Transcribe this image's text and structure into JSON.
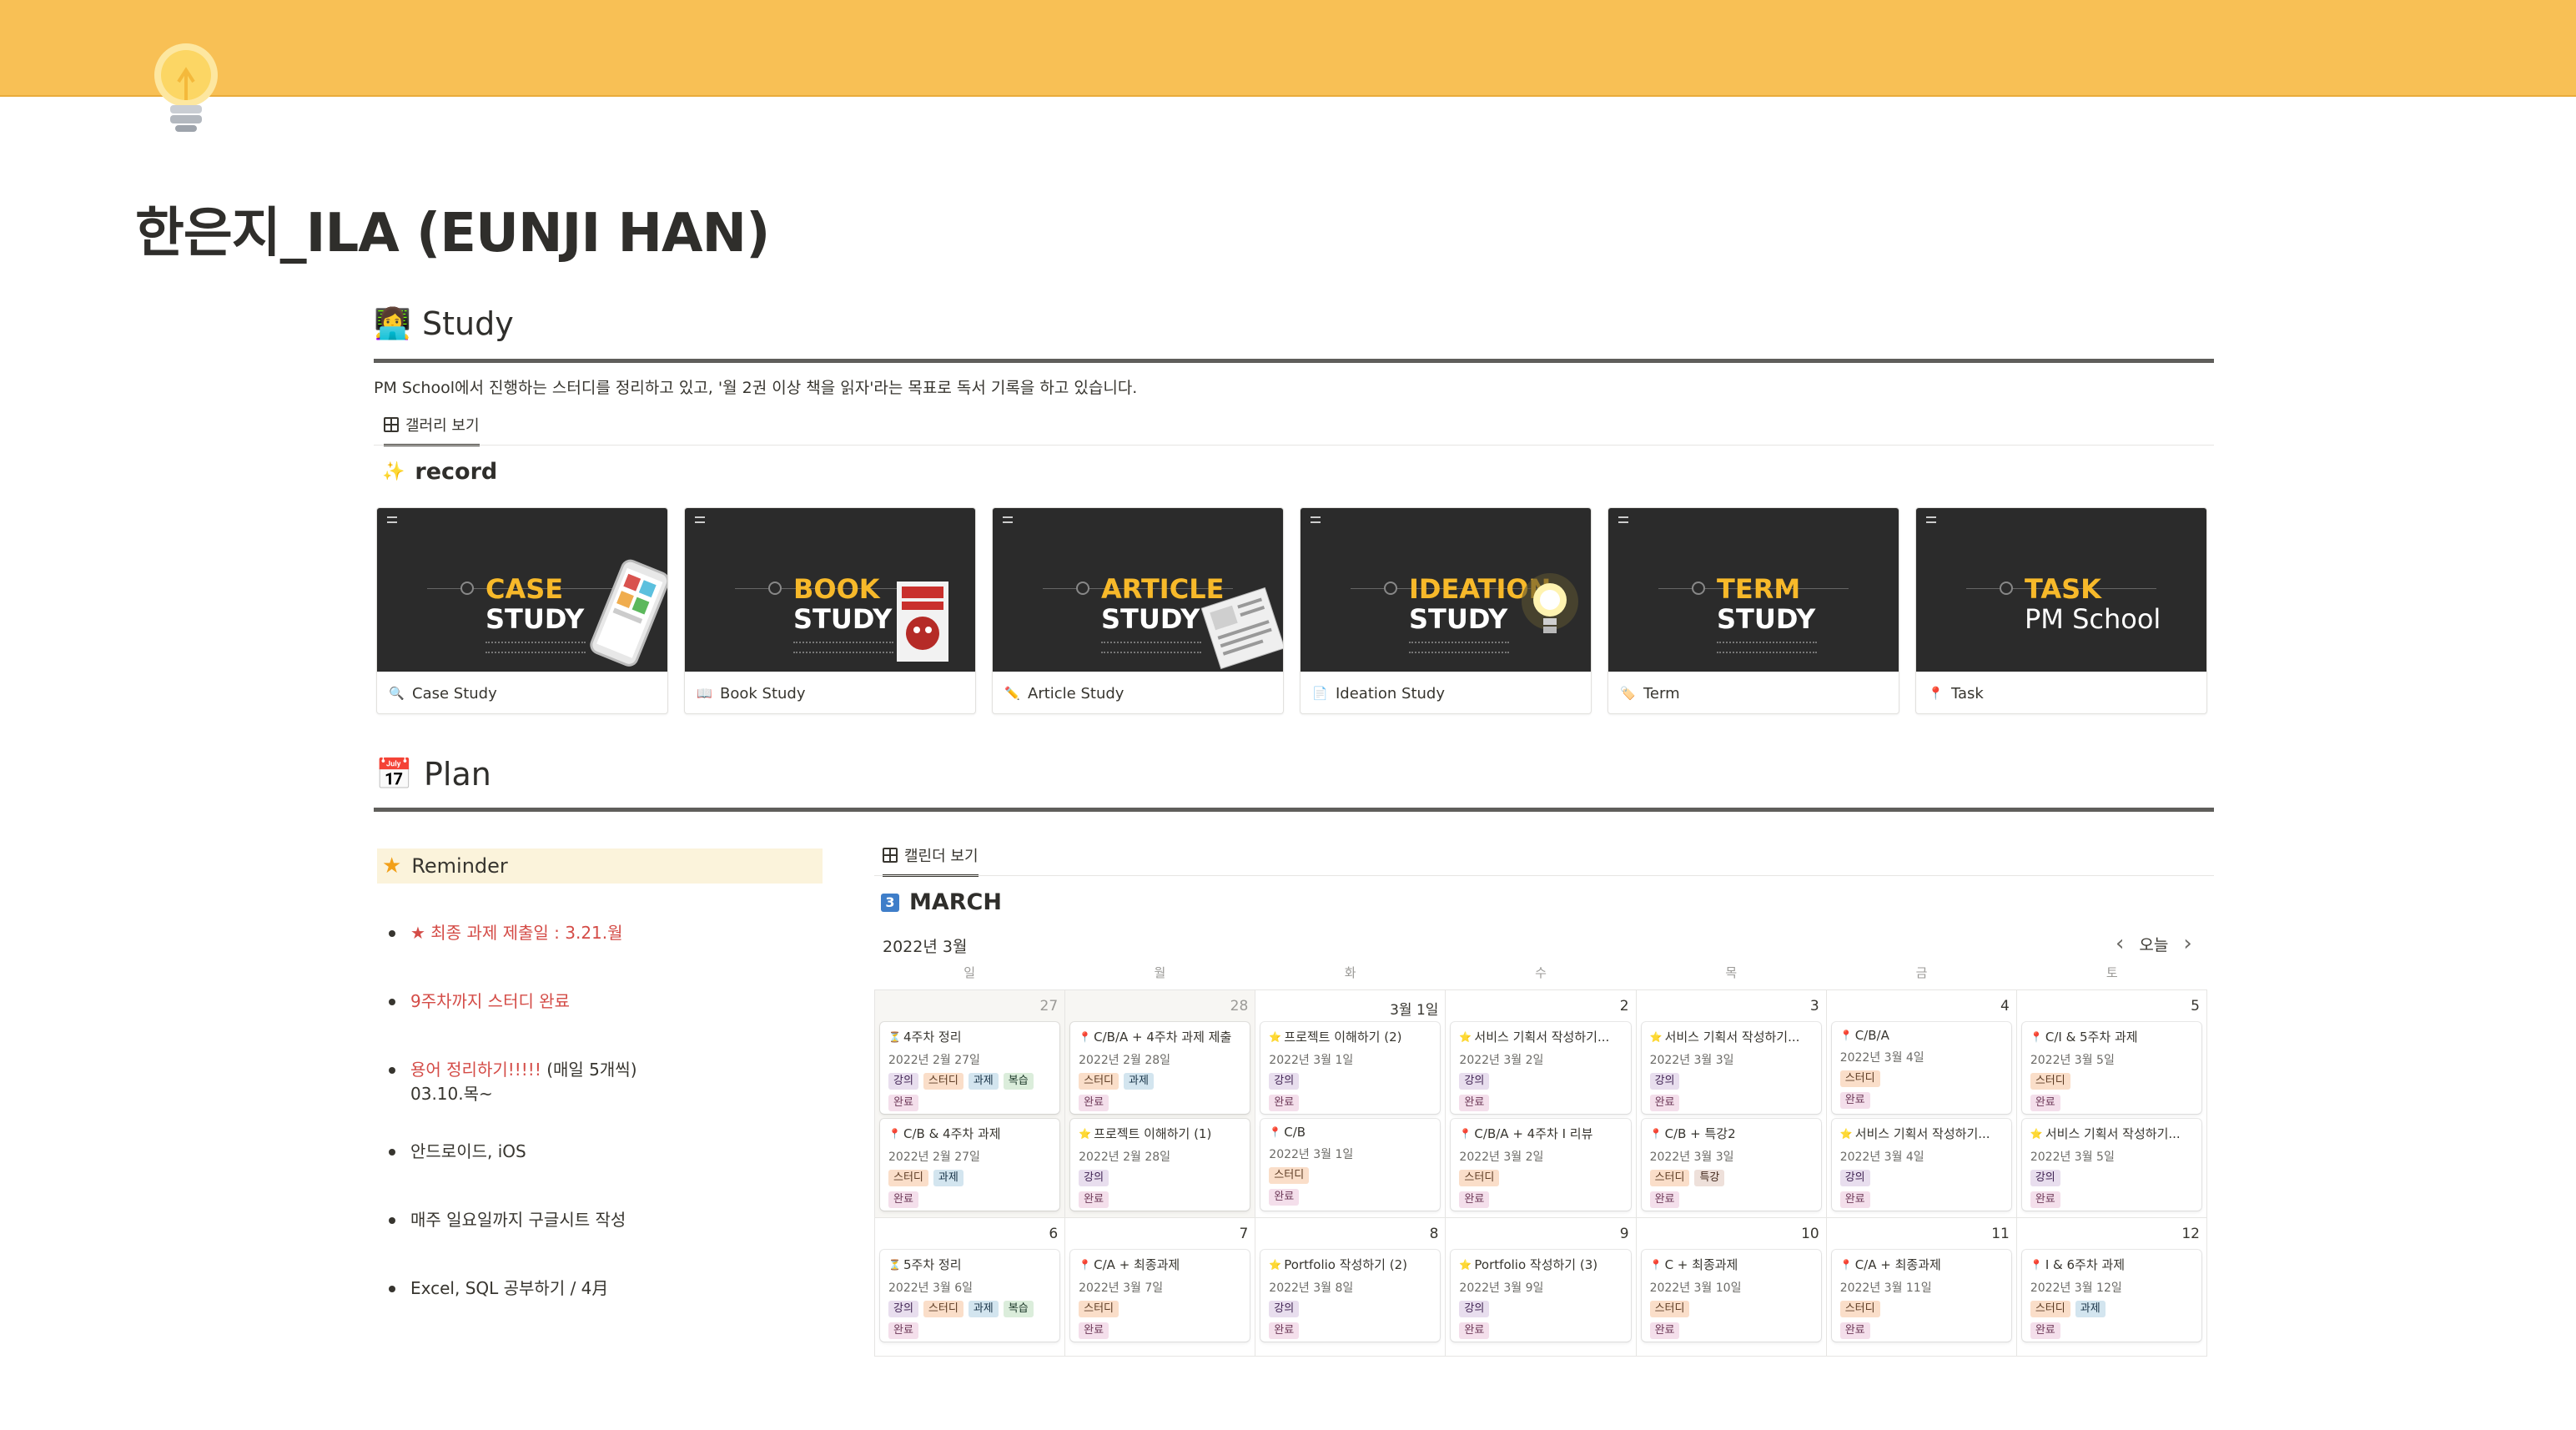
{
  "page": {
    "title": "한은지_ILA (EUNJI HAN)"
  },
  "study": {
    "heading": "Study",
    "description": "PM School에서 진행하는 스터디를 정리하고 있고, '월 2권 이상 책을 읽자'라는 목표로 독서 기록을 하고 있습니다.",
    "view_tab": "갤러리 보기",
    "db_title": "record",
    "cards": [
      {
        "t1": "CASE",
        "t2": "STUDY",
        "name": "Case Study",
        "icon": "magnifier-icon"
      },
      {
        "t1": "BOOK",
        "t2": "STUDY",
        "name": "Book Study",
        "icon": "book-icon"
      },
      {
        "t1": "ARTICLE",
        "t2": "STUDY",
        "name": "Article Study",
        "icon": "pencil-icon"
      },
      {
        "t1": "IDEATION",
        "t2": "STUDY",
        "name": "Ideation Study",
        "icon": "document-icon"
      },
      {
        "t1": "TERM",
        "t2": "STUDY",
        "name": "Term",
        "icon": "tag-icon"
      },
      {
        "t1": "TASK",
        "t2": "PM School",
        "name": "Task",
        "icon": "pin-icon"
      }
    ]
  },
  "plan": {
    "heading": "Plan",
    "reminder": {
      "title": "Reminder",
      "items": [
        {
          "text": "★ 최종 과제 제출일 : 3.21.월",
          "red": true
        },
        {
          "text": "9주차까지 스터디 완료",
          "red": true
        },
        {
          "text": "용어 정리하기!!!!!",
          "red": true,
          "suffix": " (매일 5개씩)",
          "line2": "03.10.목~"
        },
        {
          "text": "안드로이드, iOS"
        },
        {
          "text": "매주 일요일까지 구글시트 작성"
        },
        {
          "text": "Excel, SQL 공부하기 / 4月"
        }
      ]
    },
    "view_tab": "캘린더 보기",
    "db_title": "MARCH",
    "month_label": "2022년 3월",
    "today_label": "오늘",
    "weekdays": [
      "일",
      "월",
      "화",
      "수",
      "목",
      "금",
      "토"
    ],
    "week1": [
      {
        "day": "27",
        "gray": true,
        "events": [
          {
            "icon": "⏳",
            "title": "4주차 정리",
            "date": "2022년 2월 27일",
            "tags": [
              "강의",
              "스터디",
              "과제",
              "복습"
            ],
            "done": "완료"
          },
          {
            "icon": "📍",
            "title": "C/B & 4주차 과제",
            "date": "2022년 2월 27일",
            "tags": [
              "스터디",
              "과제"
            ],
            "done": "완료"
          }
        ]
      },
      {
        "day": "28",
        "gray": true,
        "events": [
          {
            "icon": "📍",
            "title": "C/B/A + 4주차 과제 제출",
            "date": "2022년 2월 28일",
            "tags": [
              "스터디",
              "과제"
            ],
            "done": "완료"
          },
          {
            "icon": "⭐",
            "title": "프로젝트 이해하기 (1)",
            "date": "2022년 2월 28일",
            "tags": [
              "강의"
            ],
            "done": "완료"
          }
        ]
      },
      {
        "day": "3월 1일",
        "events": [
          {
            "icon": "⭐",
            "title": "프로젝트 이해하기 (2)",
            "date": "2022년 3월 1일",
            "tags": [
              "강의"
            ],
            "done": "완료"
          },
          {
            "icon": "📍",
            "title": "C/B",
            "date": "2022년 3월 1일",
            "tags": [
              "스터디"
            ],
            "done": "완료"
          }
        ]
      },
      {
        "day": "2",
        "events": [
          {
            "icon": "⭐",
            "title": "서비스 기획서 작성하기...",
            "date": "2022년 3월 2일",
            "tags": [
              "강의"
            ],
            "done": "완료"
          },
          {
            "icon": "📍",
            "title": "C/B/A + 4주차 I 리뷰",
            "date": "2022년 3월 2일",
            "tags": [
              "스터디"
            ],
            "done": "완료"
          }
        ]
      },
      {
        "day": "3",
        "events": [
          {
            "icon": "⭐",
            "title": "서비스 기획서 작성하기...",
            "date": "2022년 3월 3일",
            "tags": [
              "강의"
            ],
            "done": "완료"
          },
          {
            "icon": "📍",
            "title": "C/B + 특강2",
            "date": "2022년 3월 3일",
            "tags": [
              "스터디",
              "특강"
            ],
            "done": "완료"
          }
        ]
      },
      {
        "day": "4",
        "events": [
          {
            "icon": "📍",
            "title": "C/B/A",
            "date": "2022년 3월 4일",
            "tags": [
              "스터디"
            ],
            "done": "완료"
          },
          {
            "icon": "⭐",
            "title": "서비스 기획서 작성하기...",
            "date": "2022년 3월 4일",
            "tags": [
              "강의"
            ],
            "done": "완료"
          }
        ]
      },
      {
        "day": "5",
        "events": [
          {
            "icon": "📍",
            "title": "C/I & 5주차 과제",
            "date": "2022년 3월 5일",
            "tags": [
              "스터디"
            ],
            "done": "완료"
          },
          {
            "icon": "⭐",
            "title": "서비스 기획서 작성하기...",
            "date": "2022년 3월 5일",
            "tags": [
              "강의"
            ],
            "done": "완료"
          }
        ]
      }
    ],
    "week2": [
      {
        "day": "6",
        "events": [
          {
            "icon": "⏳",
            "title": "5주차 정리",
            "date": "2022년 3월 6일",
            "tags": [
              "강의",
              "스터디",
              "과제",
              "복습"
            ],
            "done": "완료"
          }
        ]
      },
      {
        "day": "7",
        "events": [
          {
            "icon": "📍",
            "title": "C/A + 최종과제",
            "date": "2022년 3월 7일",
            "tags": [
              "스터디"
            ],
            "done": "완료"
          }
        ]
      },
      {
        "day": "8",
        "events": [
          {
            "icon": "⭐",
            "title": "Portfolio 작성하기 (2)",
            "date": "2022년 3월 8일",
            "tags": [
              "강의"
            ],
            "done": "완료"
          }
        ]
      },
      {
        "day": "9",
        "events": [
          {
            "icon": "⭐",
            "title": "Portfolio 작성하기 (3)",
            "date": "2022년 3월 9일",
            "tags": [
              "강의"
            ],
            "done": "완료"
          }
        ]
      },
      {
        "day": "10",
        "events": [
          {
            "icon": "📍",
            "title": "C + 최종과제",
            "date": "2022년 3월 10일",
            "tags": [
              "스터디"
            ],
            "done": "완료"
          }
        ]
      },
      {
        "day": "11",
        "events": [
          {
            "icon": "📍",
            "title": "C/A + 최종과제",
            "date": "2022년 3월 11일",
            "tags": [
              "스터디"
            ],
            "done": "완료"
          }
        ]
      },
      {
        "day": "12",
        "events": [
          {
            "icon": "📍",
            "title": "I & 6주차 과제",
            "date": "2022년 3월 12일",
            "tags": [
              "스터디",
              "과제"
            ],
            "done": "완료"
          }
        ]
      }
    ]
  },
  "colors": {
    "cover": "#f8c055",
    "accent_title": "#f7b92a",
    "reminder_bg": "#fbf3db",
    "red": "#d44c47"
  }
}
